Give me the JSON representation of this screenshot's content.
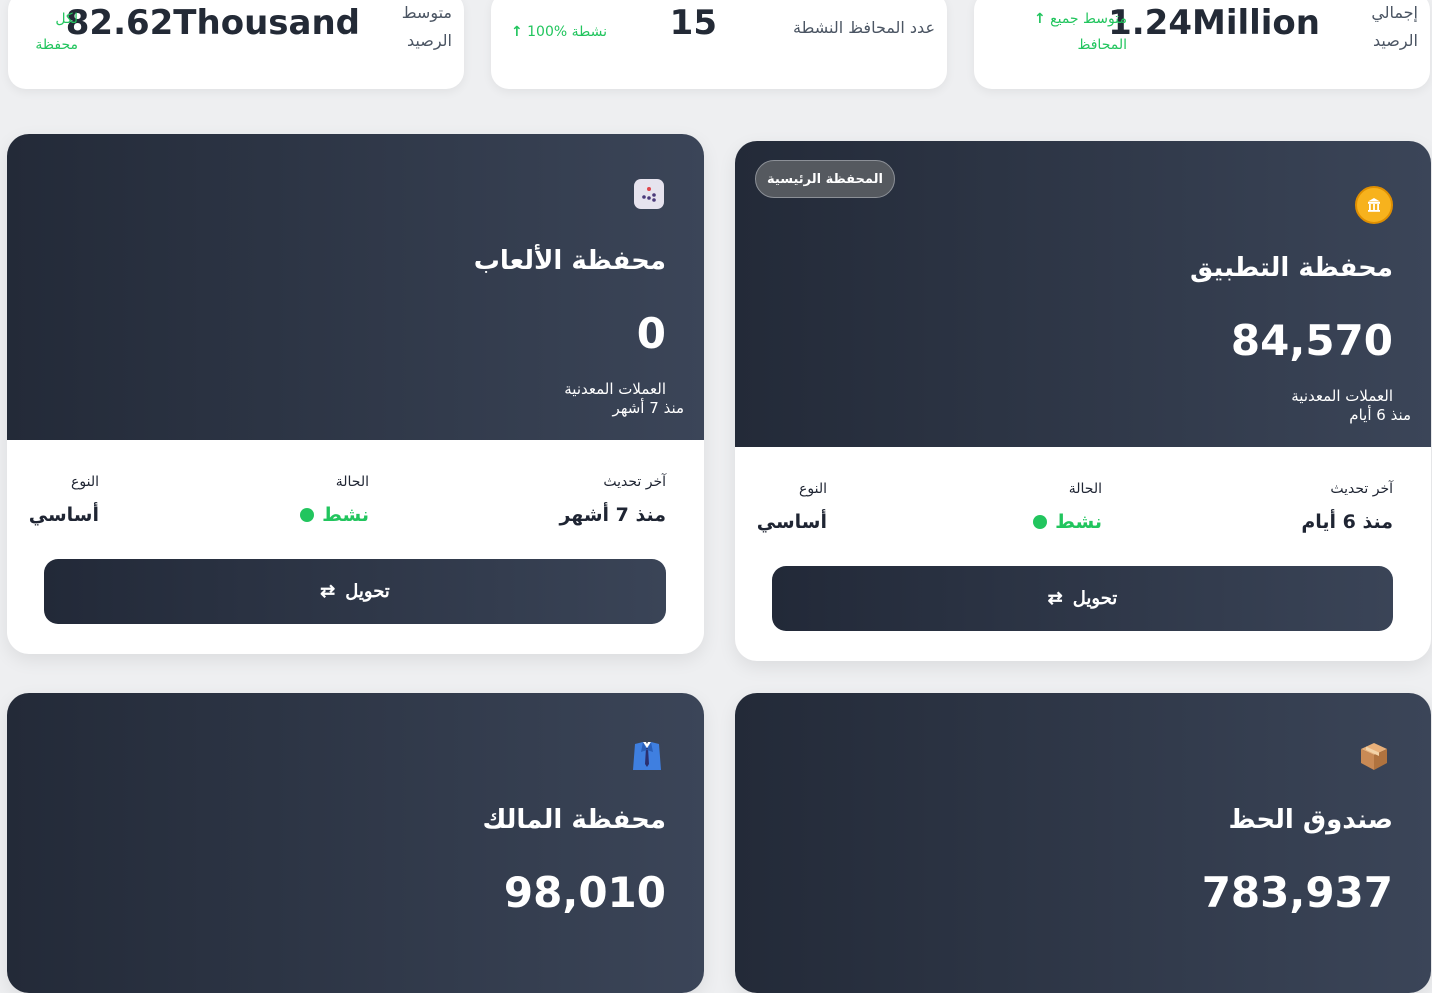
{
  "stats": {
    "total": {
      "label_line1": "إجمالي",
      "label_line2": "الرصيد",
      "value": "1.24Million",
      "trend_line1": "متوسط جميع",
      "trend_line2": "المحافظ"
    },
    "active": {
      "label": "عدد المحافظ النشطة",
      "value": "15",
      "trend": "100% نشطة"
    },
    "average": {
      "label_line1": "متوسط",
      "label_line2": "الرصيد",
      "value": "82.62Thousand",
      "trend_line1": "لكل",
      "trend_line2": "محفظة"
    }
  },
  "labels": {
    "last_update": "آخر تحديث",
    "status": "الحالة",
    "type": "النوع",
    "transfer": "تحويل",
    "unit": "العملات المعدنية"
  },
  "wallets": [
    {
      "title": "محفظة التطبيق",
      "badge": "المحفظة الرئيسية",
      "balance": "84,570",
      "since": "منذ 6 أيام",
      "last_update": "منذ 6 أيام",
      "status": "نشط",
      "type": "أساسي",
      "icon": "bank-coin-icon",
      "color": "#f7b21d"
    },
    {
      "title": "محفظة الألعاب",
      "balance": "0",
      "since": "منذ 7 أشهر",
      "last_update": "منذ 7 أشهر",
      "status": "نشط",
      "type": "أساسي",
      "icon": "dice-icon"
    },
    {
      "title": "صندوق الحظ",
      "balance": "783,937",
      "icon": "box-icon"
    },
    {
      "title": "محفظة المالك",
      "balance": "98,010",
      "icon": "suit-icon"
    }
  ],
  "colors": {
    "active": "#22c55e",
    "hero_dark": "#232a38",
    "hero_light": "#3b4558"
  }
}
